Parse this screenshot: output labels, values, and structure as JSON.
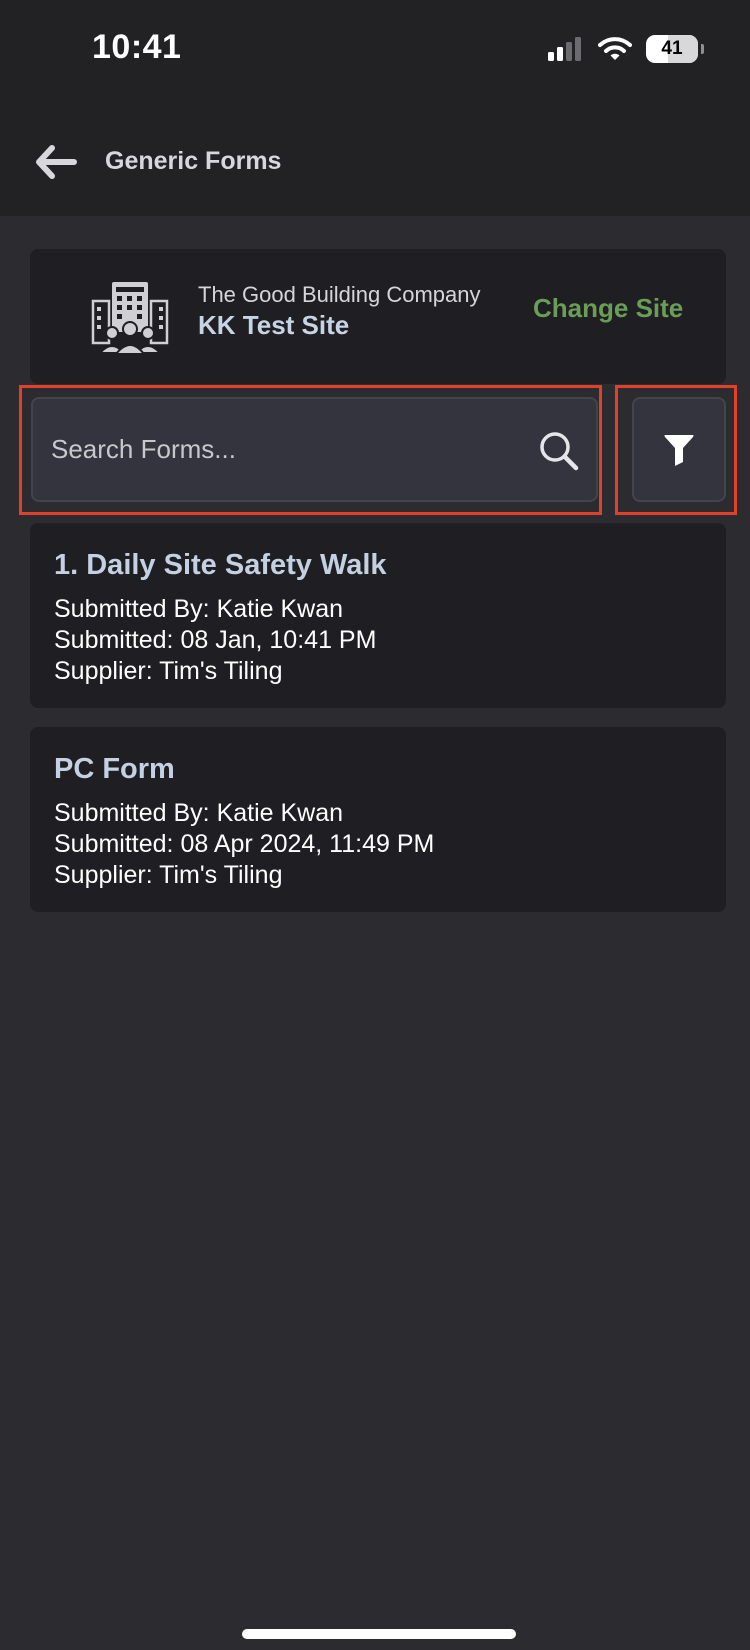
{
  "status_bar": {
    "time": "10:41",
    "battery_level": "41",
    "icons": [
      "signal-icon",
      "wifi-icon",
      "battery-icon"
    ]
  },
  "header": {
    "title": "Generic Forms",
    "back_icon": "arrow-left-icon"
  },
  "site": {
    "company": "The Good Building Company",
    "name": "KK Test Site",
    "change_label": "Change Site",
    "icon": "buildings-people-icon"
  },
  "search": {
    "placeholder": "Search Forms...",
    "value": "",
    "icon": "search-icon",
    "filter_icon": "filter-icon"
  },
  "forms": [
    {
      "title": "1. Daily Site Safety Walk",
      "submitted_by": "Submitted By: Katie Kwan",
      "submitted": "Submitted: 08 Jan, 10:41 PM",
      "supplier": "Supplier: Tim's Tiling"
    },
    {
      "title": "PC Form",
      "submitted_by": "Submitted By: Katie Kwan",
      "submitted": "Submitted: 08 Apr 2024, 11:49 PM",
      "supplier": "Supplier: Tim's Tiling"
    }
  ],
  "colors": {
    "background": "#2c2b2f",
    "header_background": "#222124",
    "card_background": "#1f1e22",
    "accent_green": "#6a9e57",
    "highlight_red": "#e0412b",
    "title_blue": "#c4d1e2"
  }
}
